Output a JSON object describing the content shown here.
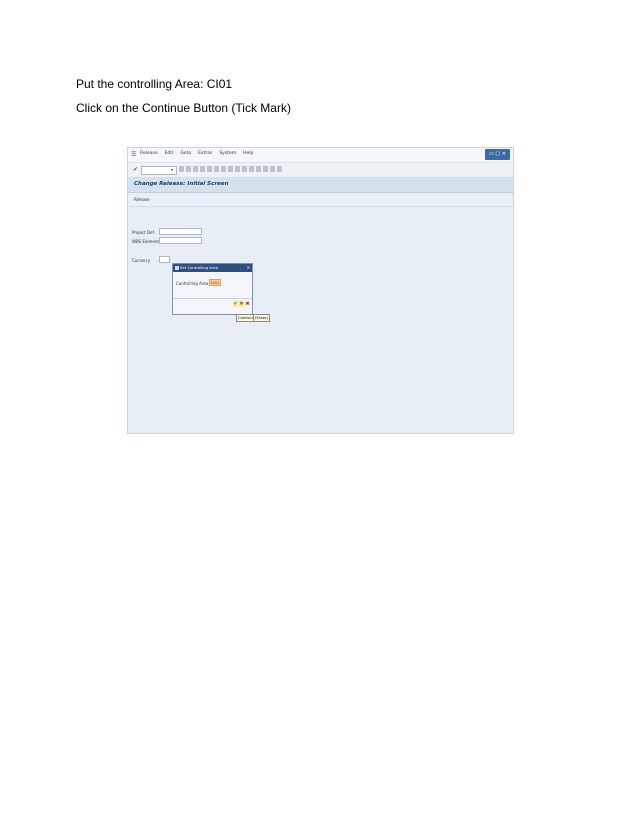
{
  "instructions": {
    "line1": "Put the controlling Area: CI01",
    "line2": "Click on the Continue Button (Tick Mark)"
  },
  "sap": {
    "menu": [
      "Release",
      "Edit",
      "Goto",
      "Extras",
      "System",
      "Help"
    ],
    "screen_title": "Change Release: Initial Screen",
    "app_button": "Release",
    "fields": {
      "project_def_label": "Project Def.",
      "wbs_label": "WBS Element",
      "currency_label": "Currency"
    },
    "dialog": {
      "title": "Set Controlling Area",
      "field_label": "Controlling Area",
      "field_value": "CI01",
      "tooltip_continue": "Continue",
      "tooltip_enter": "(Enter)"
    },
    "icons": {
      "tick": "✔",
      "check": "✱",
      "close": "✖"
    }
  }
}
